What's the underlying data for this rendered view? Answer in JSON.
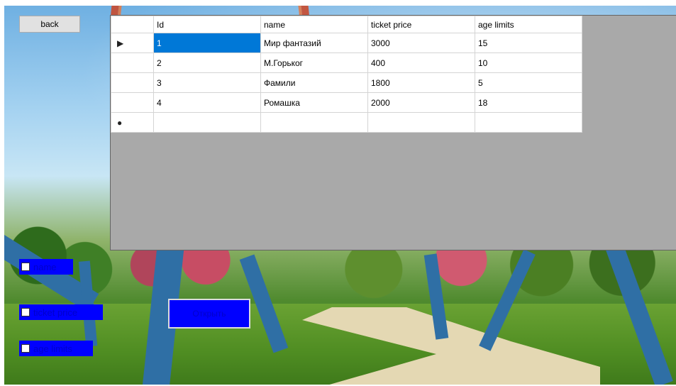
{
  "toolbar": {
    "back_label": "back"
  },
  "grid": {
    "columns": [
      "Id",
      "name",
      "ticket price",
      "age limits"
    ],
    "rows": [
      {
        "marker": "▶",
        "id": "1",
        "name": "Мир фантазий",
        "price": "3000",
        "age": "15"
      },
      {
        "marker": "",
        "id": "2",
        "name": "М.Горьког",
        "price": "400",
        "age": "10"
      },
      {
        "marker": "",
        "id": "3",
        "name": "Фамили",
        "price": "1800",
        "age": "5"
      },
      {
        "marker": "",
        "id": "4",
        "name": "Ромашка",
        "price": "2000",
        "age": "18"
      }
    ],
    "new_row_marker": "●",
    "selected_cell": "rows.0.id"
  },
  "filters": {
    "name_label": "name",
    "price_label": "ticket price",
    "age_label": "age limits"
  },
  "actions": {
    "open_label": "Открыть"
  },
  "colors": {
    "accent_blue": "#0000ff",
    "selection": "#0078d7",
    "grid_background": "#a9a9a9"
  }
}
